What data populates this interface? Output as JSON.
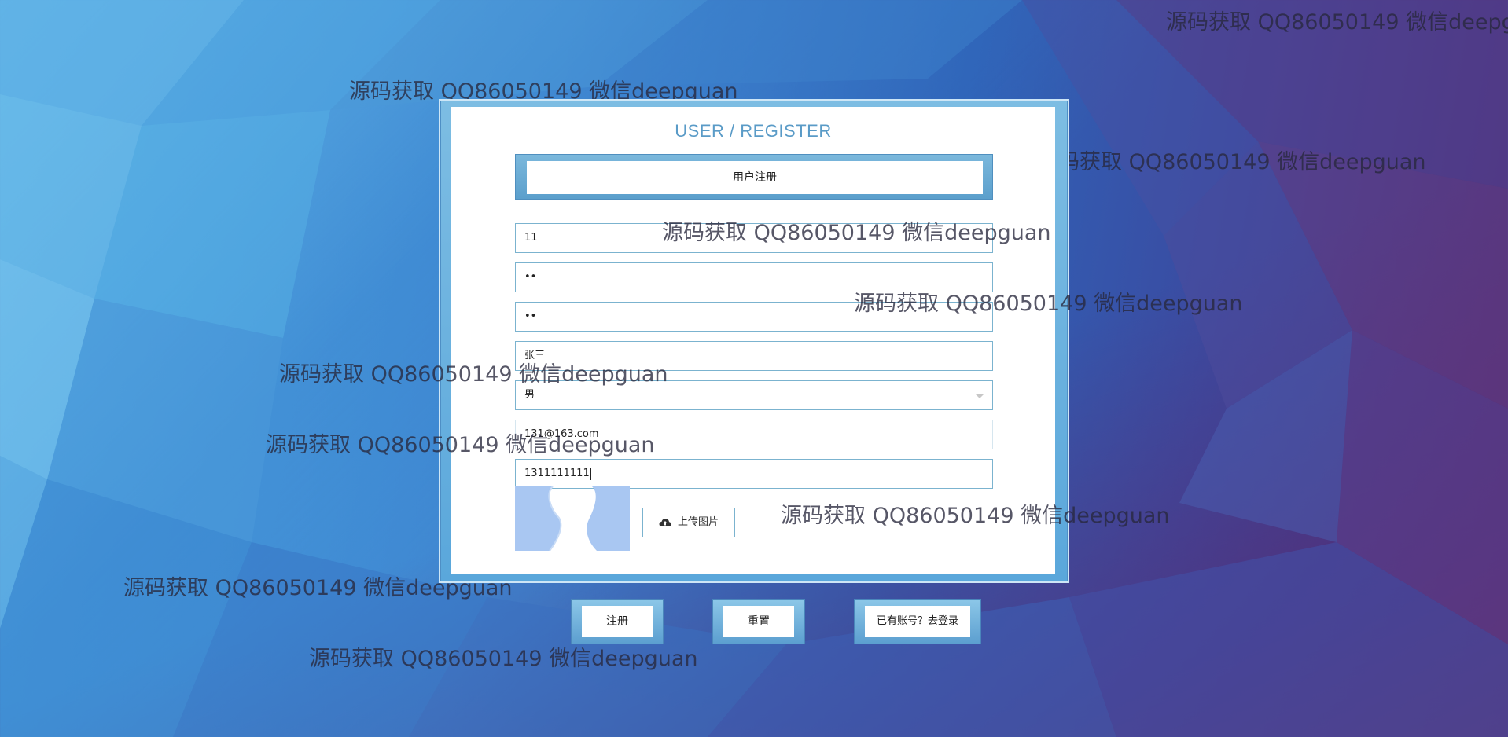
{
  "form": {
    "title": "USER / REGISTER",
    "banner_label": "用户注册",
    "username_value": "11",
    "password_value": "••",
    "confirm_password_value": "••",
    "name_value": "张三",
    "gender_selected": "男",
    "email_value": "131@163.com",
    "phone_value": "1311111111",
    "upload_label": "上传图片"
  },
  "actions": {
    "register_label": "注册",
    "reset_label": "重置",
    "login_label": "已有账号？去登录"
  },
  "watermark": {
    "text": "源码获取 QQ86050149 微信deepguan"
  },
  "icons": {
    "upload": "cloud-upload-icon",
    "select_arrow": "chevron-down-icon"
  },
  "colors": {
    "accent": "#5a9bc7",
    "frame": "#7dbde3",
    "border": "#7bb3cf"
  }
}
